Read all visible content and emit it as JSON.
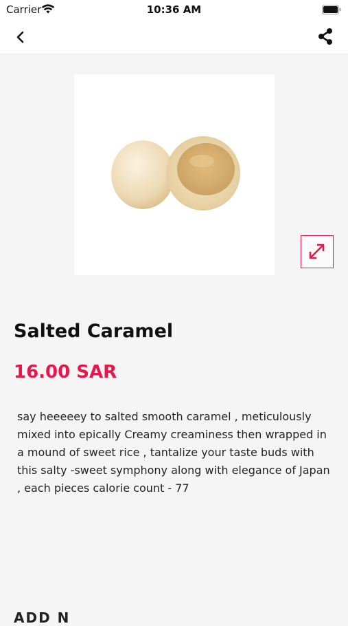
{
  "status_bar": {
    "carrier": "Carrier",
    "time": "10:36 AM"
  },
  "nav": {
    "back_icon": "chevron-left-icon",
    "share_icon": "share-icon"
  },
  "product": {
    "image_icon": "product-image",
    "expand_icon": "expand-icon",
    "name": "Salted Caramel",
    "price": "16.00 SAR",
    "description": "say heeeeey to salted smooth caramel , meticulously mixed into epically Creamy creaminess then wrapped in a mound of sweet rice , tantalize your taste buds with this salty -sweet symphony along with elegance of Japan , each pieces calorie count - 77",
    "next_section_heading": "ADD N"
  },
  "colors": {
    "accent": "#e8174a",
    "background": "#f5f5f5"
  }
}
